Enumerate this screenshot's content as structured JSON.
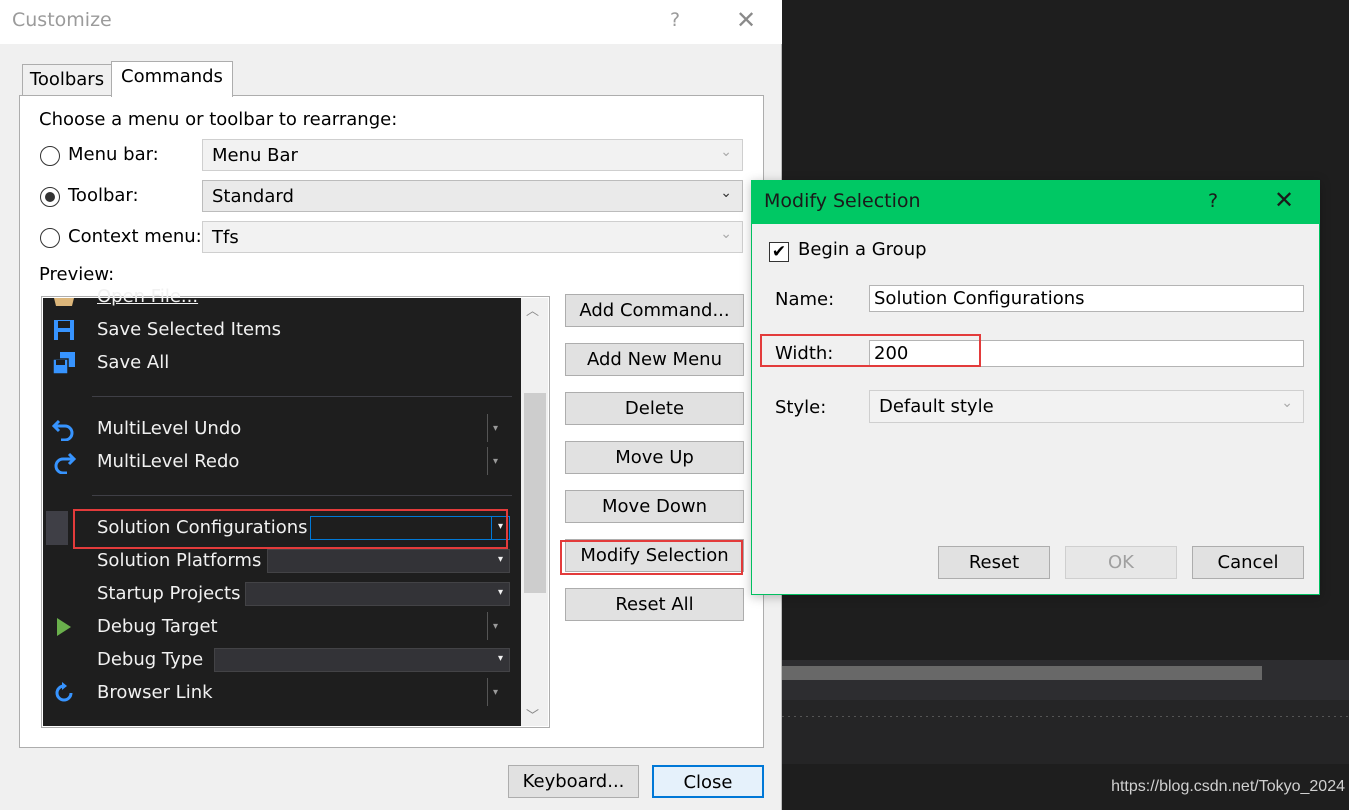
{
  "customize": {
    "title": "Customize",
    "help": "?",
    "close": "✕",
    "tabs": [
      "Toolbars",
      "Commands"
    ],
    "choose_label": "Choose a menu or toolbar to rearrange:",
    "options": [
      {
        "label": "Menu bar:",
        "value": "Menu Bar",
        "selected": false
      },
      {
        "label": "Toolbar:",
        "value": "Standard",
        "selected": true
      },
      {
        "label": "Context menu:",
        "value": "Tfs",
        "selected": false
      }
    ],
    "preview_label": "Preview:",
    "preview_items": [
      {
        "label": "Open File...",
        "icon": "open-folder-icon"
      },
      {
        "label": "Save Selected Items",
        "icon": "save-icon"
      },
      {
        "label": "Save All",
        "icon": "save-all-icon"
      },
      {
        "label": "MultiLevel Undo",
        "icon": "undo-icon"
      },
      {
        "label": "MultiLevel Redo",
        "icon": "redo-icon"
      },
      {
        "label": "Solution Configurations",
        "icon": ""
      },
      {
        "label": "Solution Platforms",
        "icon": ""
      },
      {
        "label": "Startup Projects",
        "icon": ""
      },
      {
        "label": "Debug Target",
        "icon": "play-icon"
      },
      {
        "label": "Debug Type",
        "icon": ""
      },
      {
        "label": "Browser Link",
        "icon": "refresh-icon"
      }
    ],
    "buttons": {
      "add_command": "Add Command...",
      "add_new_menu": "Add New Menu",
      "delete": "Delete",
      "move_up": "Move Up",
      "move_down": "Move Down",
      "modify_selection": "Modify Selection",
      "reset_all": "Reset All",
      "keyboard": "Keyboard...",
      "close": "Close"
    }
  },
  "modify": {
    "title": "Modify Selection",
    "help": "?",
    "close": "✕",
    "begin_group": {
      "label": "Begin a Group",
      "checked": true
    },
    "name_label": "Name:",
    "name_value": "Solution Configurations",
    "width_label": "Width:",
    "width_value": "200",
    "style_label": "Style:",
    "style_value": "Default style",
    "buttons": {
      "reset": "Reset",
      "ok": "OK",
      "cancel": "Cancel"
    },
    "accent_color": "#00c864"
  },
  "highlight_color": "#e33b3b",
  "watermark": "https://blog.csdn.net/Tokyo_2024"
}
